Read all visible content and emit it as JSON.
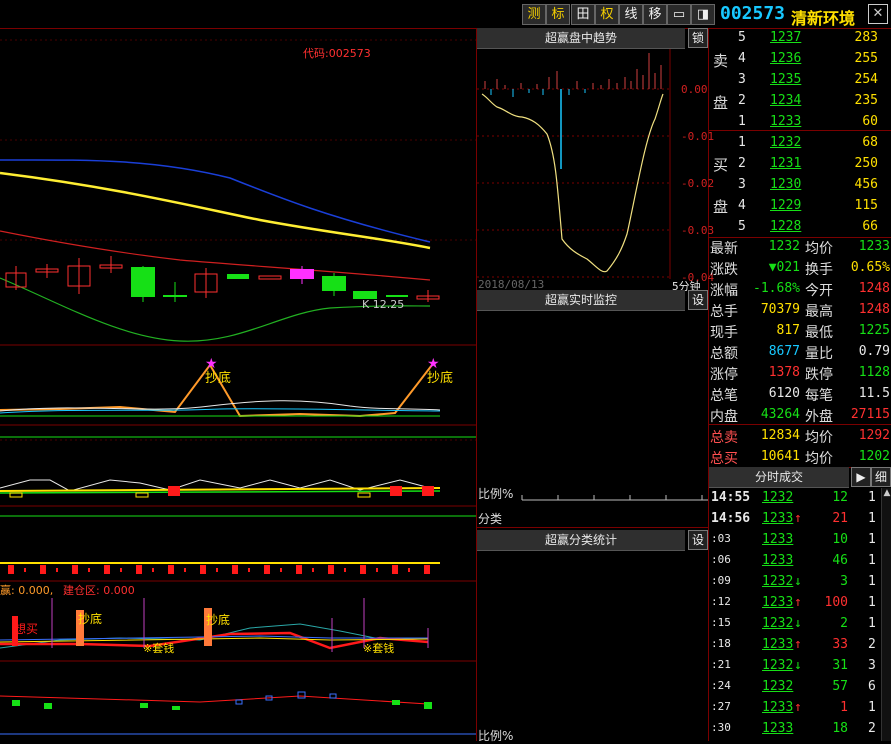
{
  "toolbar": {
    "buttons": [
      "测",
      "标",
      "田",
      "权",
      "线",
      "移",
      "▭",
      "◨"
    ],
    "code": "002573",
    "name": "清新环境",
    "close": "✕"
  },
  "chart": {
    "code_label": "代码:002573",
    "k_label": "K 12.25",
    "chaodi1": "抄底",
    "chaodi2": "抄底",
    "ind_label_a": "赢: 0.000,",
    "ind_label_b": "建仓区: 0.000",
    "sixmai": "想买",
    "chaodi3": "抄底",
    "chaodi4": "抄底",
    "huiqian1": "※套钱",
    "huiqian2": "※套钱"
  },
  "trend": {
    "title": "超赢盘中趋势",
    "lock": "锁",
    "date": "2018/08/13",
    "period": "5分钟",
    "ticks": [
      "0.00",
      "-0.01",
      "-0.02",
      "-0.03",
      "-0.04"
    ]
  },
  "monitor": {
    "title": "超赢实时监控",
    "btn": "设",
    "ratio": "比例%",
    "fenlei": "分类"
  },
  "stats": {
    "title": "超赢分类统计",
    "btn": "设",
    "ratio": "比例%"
  },
  "orderbook": {
    "sell_label": [
      "卖",
      "盘"
    ],
    "buy_label": [
      "买",
      "盘"
    ],
    "sell": [
      {
        "n": "5",
        "price": "1237",
        "vol": "283"
      },
      {
        "n": "4",
        "price": "1236",
        "vol": "255"
      },
      {
        "n": "3",
        "price": "1235",
        "vol": "254"
      },
      {
        "n": "2",
        "price": "1234",
        "vol": "235"
      },
      {
        "n": "1",
        "price": "1233",
        "vol": "60"
      }
    ],
    "buy": [
      {
        "n": "1",
        "price": "1232",
        "vol": "68"
      },
      {
        "n": "2",
        "price": "1231",
        "vol": "250"
      },
      {
        "n": "3",
        "price": "1230",
        "vol": "456"
      },
      {
        "n": "4",
        "price": "1229",
        "vol": "115"
      },
      {
        "n": "5",
        "price": "1228",
        "vol": "66"
      }
    ]
  },
  "quote": {
    "rows": [
      {
        "l1": "最新",
        "v1": "1232",
        "l2": "均价",
        "v2": "1233"
      },
      {
        "l1": "涨跌",
        "v1": "▼021",
        "l2": "换手",
        "v2": "0.65%"
      },
      {
        "l1": "涨幅",
        "v1": "-1.68%",
        "l2": "今开",
        "v2": "1248"
      },
      {
        "l1": "总手",
        "v1": "70379",
        "l2": "最高",
        "v2": "1248"
      },
      {
        "l1": "现手",
        "v1": "817",
        "l2": "最低",
        "v2": "1225"
      },
      {
        "l1": "总额",
        "v1": "8677",
        "l2": "量比",
        "v2": "0.79"
      },
      {
        "l1": "涨停",
        "v1": "1378",
        "l2": "跌停",
        "v2": "1128"
      },
      {
        "l1": "总笔",
        "v1": "6120",
        "l2": "每笔",
        "v2": "11.5"
      },
      {
        "l1": "内盘",
        "v1": "43264",
        "l2": "外盘",
        "v2": "27115"
      }
    ],
    "sum_rows": [
      {
        "l1": "总卖",
        "v1": "12834",
        "l2": "均价",
        "v2": "1292"
      },
      {
        "l1": "总买",
        "v1": "10641",
        "l2": "均价",
        "v2": "1202"
      }
    ]
  },
  "trades": {
    "title": "分时成交",
    "btn1": "▶",
    "btn2": "细",
    "rows": [
      {
        "t": "14:55",
        "p": "1232",
        "a": "",
        "v": "12",
        "n": "1"
      },
      {
        "t": "14:56",
        "p": "1233",
        "a": "↑",
        "v": "21",
        "n": "1"
      },
      {
        "t": ":03",
        "p": "1233",
        "a": "",
        "v": "10",
        "n": "1"
      },
      {
        "t": ":06",
        "p": "1233",
        "a": "",
        "v": "46",
        "n": "1"
      },
      {
        "t": ":09",
        "p": "1232",
        "a": "↓",
        "v": "3",
        "n": "1"
      },
      {
        "t": ":12",
        "p": "1233",
        "a": "↑",
        "v": "100",
        "n": "1"
      },
      {
        "t": ":15",
        "p": "1232",
        "a": "↓",
        "v": "2",
        "n": "1"
      },
      {
        "t": ":18",
        "p": "1233",
        "a": "↑",
        "v": "33",
        "n": "2"
      },
      {
        "t": ":21",
        "p": "1232",
        "a": "↓",
        "v": "31",
        "n": "3"
      },
      {
        "t": ":24",
        "p": "1232",
        "a": "",
        "v": "57",
        "n": "6"
      },
      {
        "t": ":27",
        "p": "1233",
        "a": "↑",
        "v": "1",
        "n": "1"
      },
      {
        "t": ":30",
        "p": "1233",
        "a": "",
        "v": "18",
        "n": "2"
      }
    ]
  }
}
